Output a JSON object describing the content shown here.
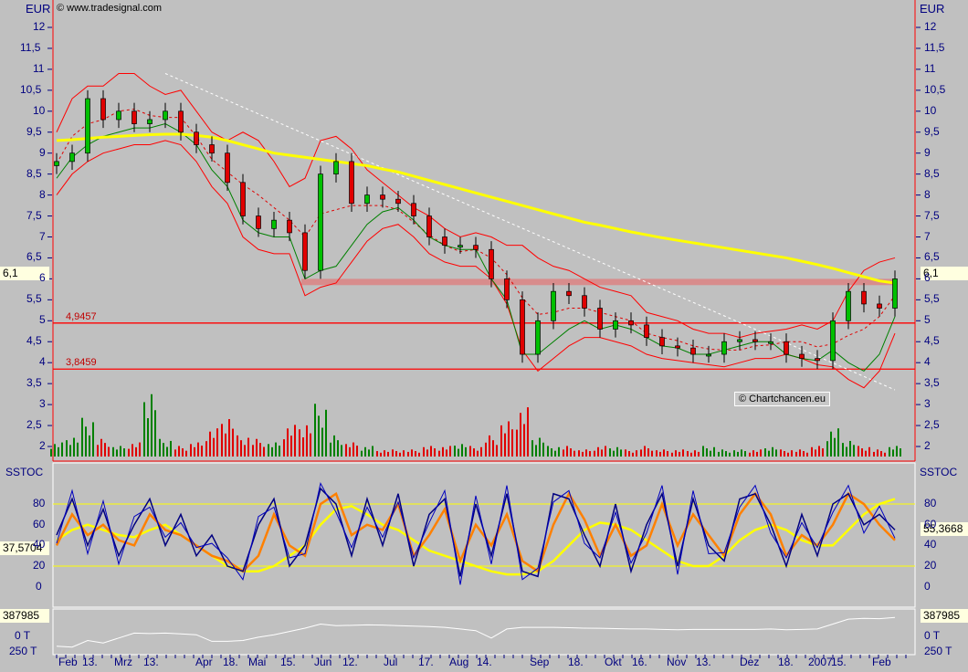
{
  "header": {
    "currency_left": "EUR",
    "currency_right": "EUR",
    "copyright": "© www.tradesignal.com",
    "watermark": "© Chartchancen.eu"
  },
  "colors": {
    "background": "#c0c0c0",
    "up": "#00c000",
    "down": "#e00000",
    "ma": "#ffff00",
    "bollinger": "#ff0000",
    "stoch_fast": "#000080",
    "stoch_orange": "#ff8000",
    "stoch_slow": "#ffff00",
    "support": "#ff0000",
    "resistance_zone": "#d88c8c"
  },
  "chart_data": [
    {
      "type": "candlestick",
      "panel": "price",
      "yunit": "EUR",
      "ylim": [
        1.7,
        12.5
      ],
      "yticks": [
        "12",
        "11,5",
        "11",
        "10,5",
        "10",
        "9,5",
        "9",
        "8,5",
        "8",
        "7,5",
        "7",
        "6,5",
        "6",
        "5,5",
        "5",
        "4,5",
        "4",
        "3,5",
        "3",
        "2,5",
        "2"
      ],
      "current_price": "6,1",
      "support_levels": [
        {
          "value": 4.9457,
          "label": "4,9457"
        },
        {
          "value": 3.8459,
          "label": "3,8459"
        }
      ],
      "resistance_zone": [
        5.85,
        6.0
      ],
      "trendline": {
        "from": {
          "date": "2006-03-23",
          "value": 10.9
        },
        "to": {
          "date": "2007-02-15",
          "value": 3.35
        }
      },
      "dates": [
        "2006-02-02",
        "2006-02-09",
        "2006-02-16",
        "2006-02-23",
        "2006-03-02",
        "2006-03-09",
        "2006-03-16",
        "2006-03-23",
        "2006-03-30",
        "2006-04-06",
        "2006-04-13",
        "2006-04-20",
        "2006-04-27",
        "2006-05-04",
        "2006-05-11",
        "2006-05-18",
        "2006-05-25",
        "2006-06-01",
        "2006-06-08",
        "2006-06-15",
        "2006-06-22",
        "2006-06-29",
        "2006-07-06",
        "2006-07-13",
        "2006-07-20",
        "2006-07-27",
        "2006-08-03",
        "2006-08-10",
        "2006-08-17",
        "2006-08-24",
        "2006-08-31",
        "2006-09-07",
        "2006-09-14",
        "2006-09-21",
        "2006-09-28",
        "2006-10-05",
        "2006-10-12",
        "2006-10-19",
        "2006-10-26",
        "2006-11-02",
        "2006-11-09",
        "2006-11-16",
        "2006-11-23",
        "2006-11-30",
        "2006-12-07",
        "2006-12-14",
        "2006-12-21",
        "2006-12-28",
        "2007-01-04",
        "2007-01-11",
        "2007-01-18",
        "2007-01-25",
        "2007-02-01",
        "2007-02-08",
        "2007-02-15"
      ],
      "close": [
        8.8,
        9.0,
        10.3,
        9.8,
        10.0,
        9.7,
        9.8,
        10.0,
        9.5,
        9.2,
        9.0,
        8.3,
        7.5,
        7.2,
        7.4,
        7.1,
        6.2,
        8.5,
        8.8,
        7.8,
        8.0,
        7.9,
        7.8,
        7.5,
        7.0,
        6.8,
        6.8,
        6.7,
        6.0,
        5.5,
        4.2,
        5.0,
        5.7,
        5.6,
        5.3,
        4.8,
        5.0,
        4.9,
        4.6,
        4.4,
        4.35,
        4.2,
        4.2,
        4.5,
        4.55,
        4.5,
        4.5,
        4.2,
        4.1,
        4.05,
        5.0,
        5.7,
        5.4,
        5.3,
        6.0
      ],
      "ma200": [
        9.3,
        9.32,
        9.35,
        9.38,
        9.4,
        9.42,
        9.44,
        9.45,
        9.45,
        9.42,
        9.38,
        9.3,
        9.2,
        9.1,
        9.0,
        8.95,
        8.9,
        8.85,
        8.8,
        8.75,
        8.7,
        8.62,
        8.55,
        8.45,
        8.35,
        8.25,
        8.15,
        8.05,
        7.95,
        7.85,
        7.75,
        7.65,
        7.55,
        7.45,
        7.35,
        7.28,
        7.2,
        7.12,
        7.05,
        6.98,
        6.92,
        6.86,
        6.8,
        6.74,
        6.68,
        6.62,
        6.56,
        6.5,
        6.42,
        6.34,
        6.25,
        6.15,
        6.05,
        5.95,
        5.9
      ],
      "bollinger_upper": [
        9.5,
        10.3,
        10.6,
        10.6,
        10.9,
        10.9,
        10.6,
        10.4,
        10.5,
        10.0,
        9.5,
        9.3,
        9.5,
        9.3,
        8.8,
        8.2,
        8.4,
        9.3,
        9.4,
        9.1,
        8.6,
        8.3,
        8.0,
        7.7,
        7.5,
        7.2,
        7.0,
        7.1,
        7.0,
        6.8,
        6.8,
        6.5,
        6.3,
        6.2,
        6.0,
        5.8,
        5.7,
        5.6,
        5.2,
        5.1,
        5.0,
        4.8,
        4.7,
        4.7,
        4.6,
        4.7,
        4.75,
        4.8,
        4.9,
        4.8,
        5.0,
        5.7,
        6.2,
        6.4,
        6.5
      ],
      "bollinger_lower": [
        8.0,
        8.5,
        8.8,
        9.0,
        9.1,
        9.2,
        9.2,
        9.3,
        9.2,
        8.8,
        8.2,
        7.8,
        7.0,
        6.7,
        6.6,
        6.6,
        5.6,
        5.8,
        5.9,
        6.4,
        6.9,
        7.2,
        7.3,
        7.0,
        6.6,
        6.4,
        6.3,
        6.3,
        6.0,
        5.4,
        4.3,
        3.8,
        4.1,
        4.4,
        4.6,
        4.6,
        4.5,
        4.4,
        4.2,
        4.1,
        4.05,
        4.0,
        3.95,
        3.9,
        4.0,
        4.1,
        4.1,
        4.2,
        4.1,
        3.95,
        3.9,
        3.6,
        3.4,
        3.8,
        4.7
      ],
      "volume_relative": [
        0.4,
        0.6,
        1.1,
        0.5,
        0.3,
        0.4,
        2.0,
        0.5,
        0.3,
        0.4,
        0.8,
        1.2,
        0.6,
        0.5,
        0.4,
        0.9,
        1.0,
        1.5,
        0.6,
        0.4,
        0.3,
        0.2,
        0.2,
        0.2,
        0.3,
        0.3,
        0.4,
        0.3,
        0.6,
        1.0,
        1.4,
        0.6,
        0.3,
        0.3,
        0.2,
        0.3,
        0.3,
        0.2,
        0.3,
        0.2,
        0.2,
        0.2,
        0.3,
        0.2,
        0.2,
        0.2,
        0.3,
        0.2,
        0.2,
        0.3,
        0.8,
        0.5,
        0.3,
        0.2,
        0.3
      ]
    },
    {
      "type": "line",
      "panel": "SSTOC",
      "title": "SSTOC",
      "ylim": [
        -10,
        100
      ],
      "yticks": [
        "80",
        "60",
        "40",
        "20",
        "0"
      ],
      "levels": [
        80,
        20
      ],
      "current_left": "37,5704",
      "current_right": "55,3668",
      "fast": [
        50,
        85,
        40,
        75,
        30,
        60,
        85,
        40,
        70,
        30,
        50,
        20,
        15,
        60,
        85,
        20,
        40,
        95,
        80,
        30,
        85,
        40,
        90,
        20,
        70,
        85,
        10,
        80,
        30,
        90,
        15,
        10,
        90,
        85,
        50,
        20,
        80,
        15,
        60,
        90,
        20,
        85,
        40,
        25,
        85,
        90,
        60,
        20,
        70,
        30,
        80,
        90,
        60,
        70,
        55
      ],
      "orange": [
        40,
        70,
        50,
        60,
        45,
        40,
        70,
        55,
        50,
        40,
        30,
        25,
        15,
        30,
        70,
        40,
        30,
        80,
        90,
        50,
        60,
        55,
        80,
        30,
        50,
        75,
        25,
        60,
        40,
        70,
        25,
        15,
        60,
        90,
        65,
        30,
        60,
        30,
        40,
        80,
        40,
        70,
        50,
        30,
        70,
        90,
        70,
        30,
        50,
        40,
        60,
        90,
        80,
        60,
        45
      ],
      "slow": [
        45,
        55,
        60,
        55,
        50,
        48,
        55,
        60,
        50,
        40,
        30,
        20,
        15,
        15,
        20,
        30,
        40,
        60,
        75,
        78,
        70,
        60,
        55,
        45,
        35,
        30,
        25,
        20,
        15,
        12,
        12,
        15,
        25,
        40,
        55,
        62,
        60,
        55,
        45,
        35,
        25,
        20,
        20,
        30,
        45,
        55,
        60,
        55,
        45,
        40,
        40,
        55,
        70,
        80,
        85
      ]
    },
    {
      "type": "line",
      "panel": "volume-indicator",
      "yticks": [
        "0 T",
        "250 T"
      ],
      "current": "387985",
      "values": [
        -120,
        -130,
        -50,
        -80,
        -20,
        40,
        35,
        40,
        30,
        20,
        -60,
        -60,
        -50,
        -10,
        20,
        60,
        100,
        150,
        130,
        135,
        140,
        138,
        130,
        125,
        120,
        110,
        90,
        70,
        -20,
        90,
        110,
        110,
        110,
        105,
        100,
        98,
        95,
        90,
        90,
        85,
        80,
        85,
        85,
        85,
        85,
        85,
        90,
        80,
        85,
        90,
        150,
        210,
        220,
        215,
        230
      ]
    }
  ],
  "xaxis": {
    "labels": [
      "Feb",
      "13.",
      "Mrz",
      "13.",
      "Apr",
      "18.",
      "Mai",
      "15.",
      "Jun",
      "12.",
      "Jul",
      "17.",
      "Aug",
      "14.",
      "Sep",
      "18.",
      "Okt",
      "16.",
      "Nov",
      "13.",
      "Dez",
      "18.",
      "2007",
      "15.",
      "Feb"
    ]
  }
}
